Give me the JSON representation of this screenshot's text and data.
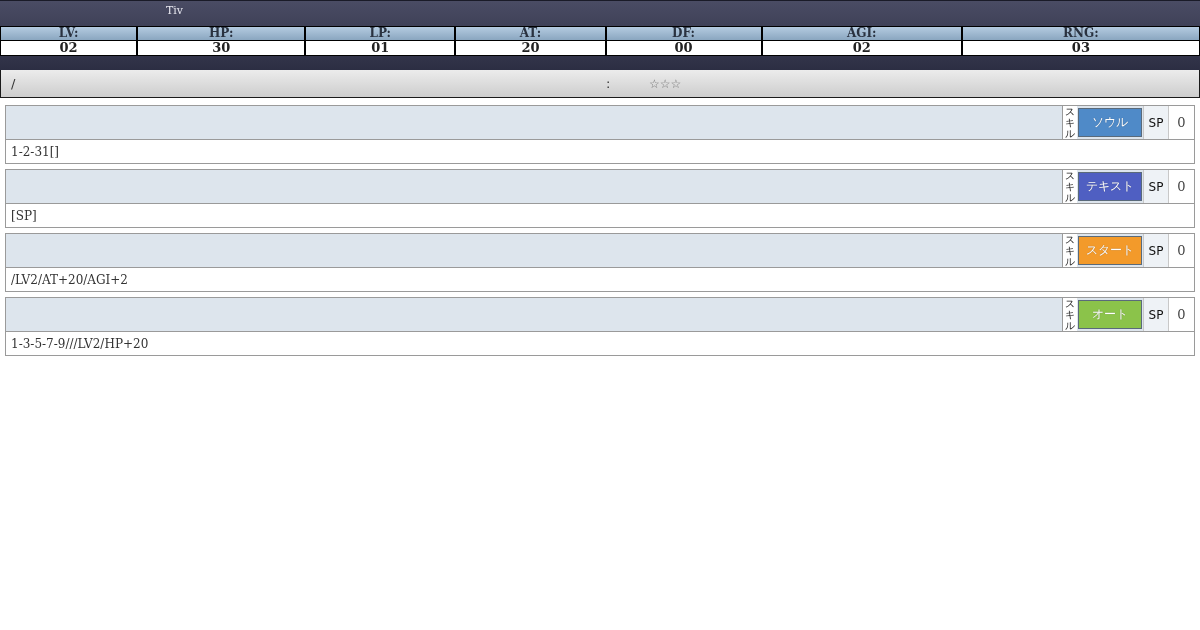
{
  "character": {
    "name": "Tiv"
  },
  "stats": [
    {
      "label": "LV:",
      "value": "02"
    },
    {
      "label": "HP:",
      "value": "30"
    },
    {
      "label": "LP:",
      "value": "01"
    },
    {
      "label": "AT:",
      "value": "20"
    },
    {
      "label": "DF:",
      "value": "00"
    },
    {
      "label": "AGI:",
      "value": "02"
    },
    {
      "label": "RNG:",
      "value": "03"
    }
  ],
  "info_bar": {
    "left_text": "/",
    "middle_text": ":",
    "rarity": "☆☆☆"
  },
  "skills": [
    {
      "tag": "スキル",
      "type": "ソウル",
      "color": "#4f8ac8",
      "sp_label": "SP",
      "sp": "0",
      "description": "1-2-31[]"
    },
    {
      "tag": "スキル",
      "type": "テキスト",
      "color": "#4f5fc2",
      "sp_label": "SP",
      "sp": "0",
      "description": "[SP]"
    },
    {
      "tag": "スキル",
      "type": "スタート",
      "color": "#f39a2a",
      "sp_label": "SP",
      "sp": "0",
      "description": "/LV2/AT+20/AGI+2"
    },
    {
      "tag": "スキル",
      "type": "オート",
      "color": "#8bc34a",
      "sp_label": "SP",
      "sp": "0",
      "description": "1-3-5-7-9///LV2/HP+20"
    }
  ]
}
